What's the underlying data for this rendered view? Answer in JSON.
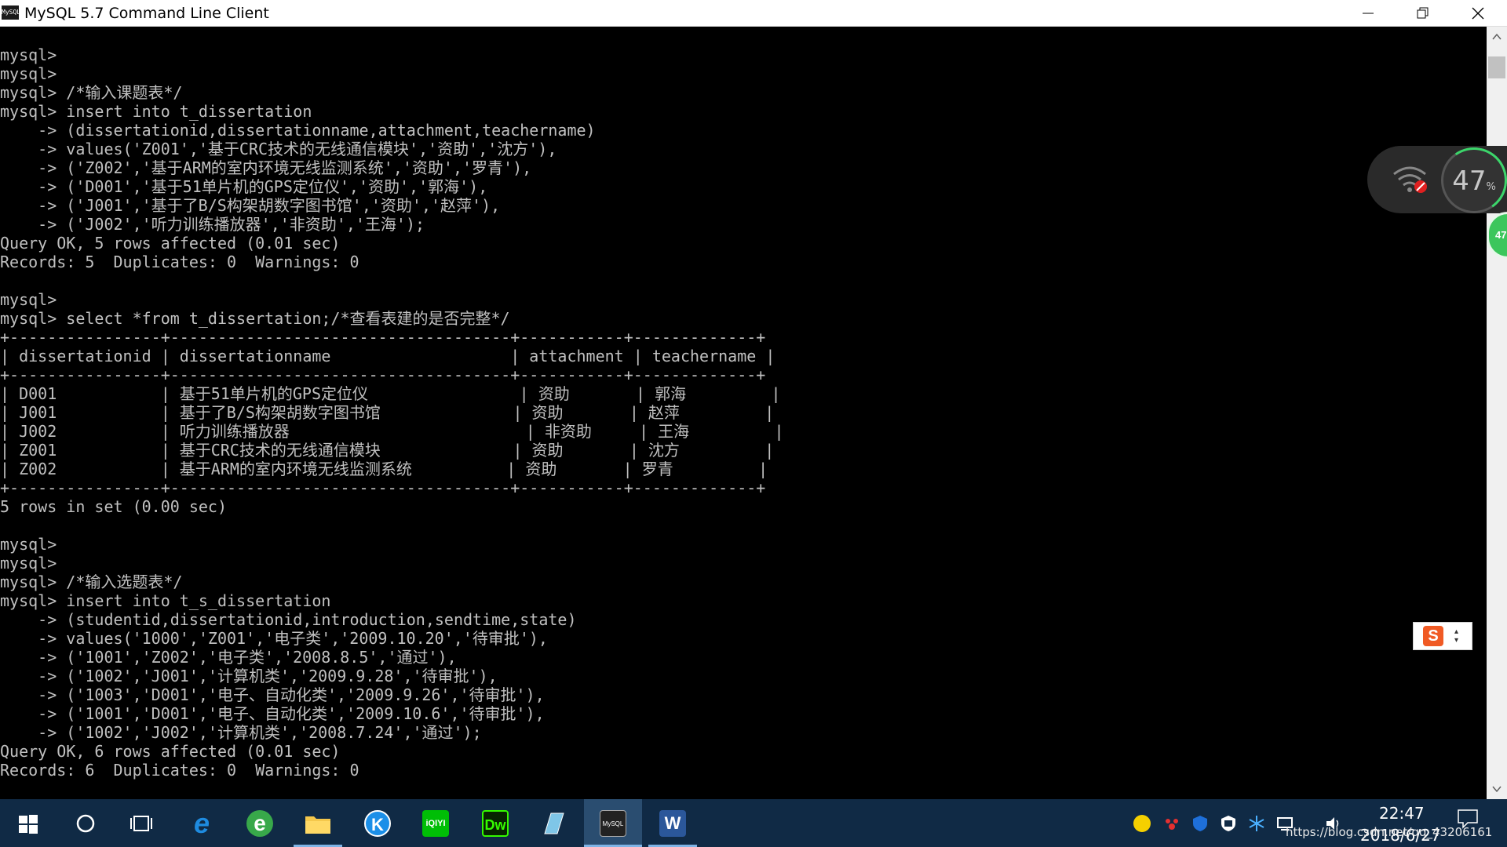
{
  "window": {
    "title": "MySQL 5.7 Command Line Client",
    "icon_text": "MySQL"
  },
  "console": {
    "lines": [
      "mysql>",
      "mysql>",
      "mysql> /*输入课题表*/",
      "mysql> insert into t_dissertation",
      "    -> (dissertationid,dissertationname,attachment,teachername)",
      "    -> values('Z001','基于CRC技术的无线通信模块','资助','沈方'),",
      "    -> ('Z002','基于ARM的室内环境无线监测系统','资助','罗青'),",
      "    -> ('D001','基于51单片机的GPS定位仪','资助','郭海'),",
      "    -> ('J001','基于了B/S构架胡数字图书馆','资助','赵萍'),",
      "    -> ('J002','听力训练播放器','非资助','王海');",
      "Query OK, 5 rows affected (0.01 sec)",
      "Records: 5  Duplicates: 0  Warnings: 0",
      "",
      "mysql>",
      "mysql> select *from t_dissertation;/*查看表建的是否完整*/",
      "+----------------+------------------------------------+-----------+-------------+",
      "| dissertationid | dissertationname                   | attachment | teachername |",
      "+----------------+------------------------------------+-----------+-------------+",
      "| D001           | 基于51单片机的GPS定位仪                | 资助       | 郭海         |",
      "| J001           | 基于了B/S构架胡数字图书馆              | 资助       | 赵萍         |",
      "| J002           | 听力训练播放器                         | 非资助     | 王海         |",
      "| Z001           | 基于CRC技术的无线通信模块              | 资助       | 沈方         |",
      "| Z002           | 基于ARM的室内环境无线监测系统          | 资助       | 罗青         |",
      "+----------------+------------------------------------+-----------+-------------+",
      "5 rows in set (0.00 sec)",
      "",
      "mysql>",
      "mysql>",
      "mysql> /*输入选题表*/",
      "mysql> insert into t_s_dissertation",
      "    -> (studentid,dissertationid,introduction,sendtime,state)",
      "    -> values('1000','Z001','电子类','2009.10.20','待审批'),",
      "    -> ('1001','Z002','电子类','2008.8.5','通过'),",
      "    -> ('1002','J001','计算机类','2009.9.28','待审批'),",
      "    -> ('1003','D001','电子、自动化类','2009.9.26','待审批'),",
      "    -> ('1001','D001','电子、自动化类','2009.10.6','待审批'),",
      "    -> ('1002','J002','计算机类','2008.7.24','通过');",
      "Query OK, 6 rows affected (0.01 sec)",
      "Records: 6  Duplicates: 0  Warnings: 0"
    ]
  },
  "floating_widget": {
    "percent": "47",
    "percent_sign": "%",
    "ball_text": "47"
  },
  "ime": {
    "label": "S"
  },
  "taskbar": {
    "apps": [
      {
        "name": "start",
        "icon": "windows-logo-icon",
        "label": ""
      },
      {
        "name": "cortana",
        "icon": "search-circle-icon",
        "label": ""
      },
      {
        "name": "task-view",
        "icon": "task-view-icon",
        "label": ""
      },
      {
        "name": "edge",
        "icon": "edge-icon",
        "label": "e"
      },
      {
        "name": "browser-360",
        "icon": "browser-360-icon",
        "label": "e"
      },
      {
        "name": "explorer",
        "icon": "folder-icon",
        "label": ""
      },
      {
        "name": "kugou",
        "icon": "kugou-icon",
        "label": "K"
      },
      {
        "name": "iqiyi",
        "icon": "iqiyi-icon",
        "label": "iQIYI"
      },
      {
        "name": "dreamweaver",
        "icon": "dreamweaver-icon",
        "label": "Dw"
      },
      {
        "name": "notepad",
        "icon": "notepad-icon",
        "label": ""
      },
      {
        "name": "mysql",
        "icon": "mysql-console-icon",
        "label": "MySQL"
      },
      {
        "name": "word",
        "icon": "word-icon",
        "label": "W"
      }
    ],
    "clock_time": "22:47",
    "clock_date": "2018/6/27",
    "watermark": "https://blog.csdn.net/qq_43206161"
  },
  "colors": {
    "console_bg": "#000000",
    "console_text": "#c0c0c0",
    "taskbar_bg": "#102a45",
    "accent": "#7fb4e6"
  }
}
